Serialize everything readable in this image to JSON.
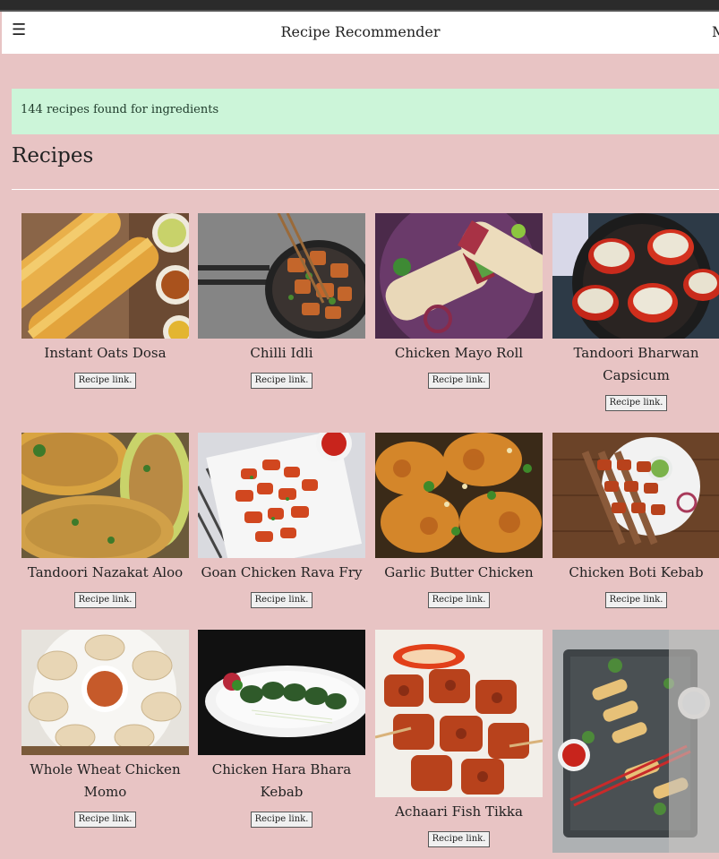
{
  "navbar": {
    "menu_icon": "hamburger-menu-icon",
    "menu_glyph": "☰",
    "title": "Recipe Recommender",
    "right_text": "M"
  },
  "alert": {
    "message": "144 recipes found for ingredients"
  },
  "heading": "Recipes",
  "button_label": "Recipe link.",
  "recipes": [
    {
      "name": "Instant Oats Dosa"
    },
    {
      "name": "Chilli Idli"
    },
    {
      "name": "Chicken Mayo Roll"
    },
    {
      "name": "Tandoori Bharwan Capsicum"
    },
    {
      "name": "Tandoori Nazakat Aloo"
    },
    {
      "name": "Goan Chicken Rava Fry"
    },
    {
      "name": "Garlic Butter Chicken"
    },
    {
      "name": "Chicken Boti Kebab"
    },
    {
      "name": "Whole Wheat Chicken Momo"
    },
    {
      "name": "Chicken Hara Bhara Kebab"
    },
    {
      "name": "Achaari Fish Tikka"
    },
    {
      "name": ""
    }
  ]
}
